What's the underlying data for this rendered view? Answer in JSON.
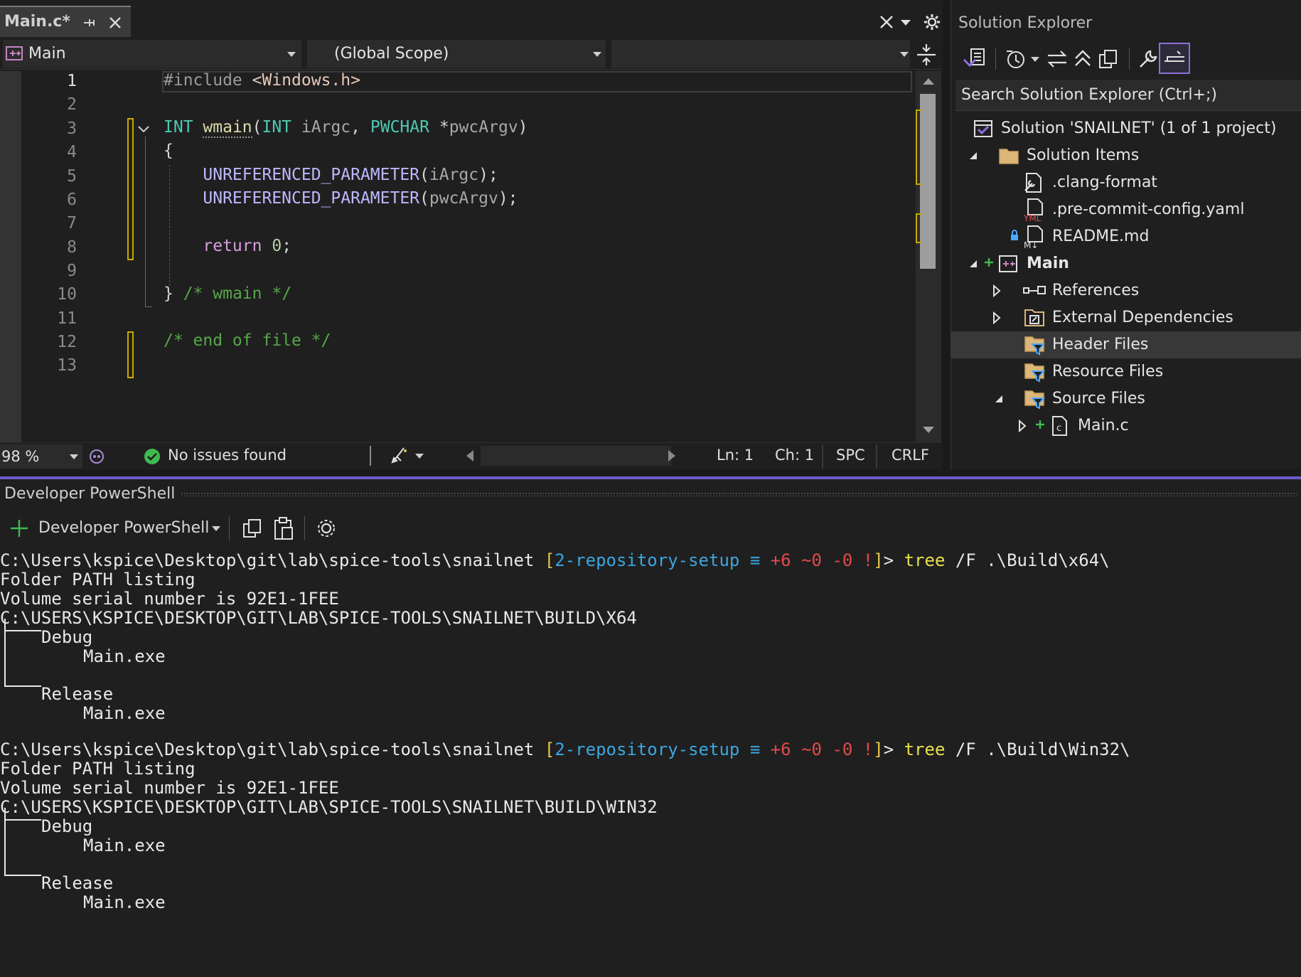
{
  "editor": {
    "tab": {
      "title": "Main.c*"
    },
    "nav": {
      "project": "Main",
      "scope": "(Global Scope)",
      "member": ""
    },
    "line_numbers": [
      "1",
      "2",
      "3",
      "4",
      "5",
      "6",
      "7",
      "8",
      "9",
      "10",
      "11",
      "12",
      "13"
    ],
    "code": {
      "l1_pp": "#include",
      "l1_inc": "<Windows.h>",
      "l3_type1": "INT",
      "l3_fn": "wmain",
      "l3_p1": "(",
      "l3_type2": "INT",
      "l3_arg1": "iArgc",
      "l3_comma": ",",
      "l3_type3": "PWCHAR",
      "l3_star": "*",
      "l3_arg2": "pwcArgv",
      "l3_p2": ")",
      "l4": "{",
      "l5_mac": "UNREFERENCED_PARAMETER",
      "l5_open": "(",
      "l5_arg": "iArgc",
      "l5_close": ");",
      "l6_mac": "UNREFERENCED_PARAMETER",
      "l6_open": "(",
      "l6_arg": "pwcArgv",
      "l6_close": ");",
      "l8_kw": "return",
      "l8_num": "0",
      "l8_semi": ";",
      "l10_brace": "}",
      "l10_com": "/* wmain */",
      "l12_com": "/* end of file */"
    },
    "status": {
      "zoom": "98 %",
      "issues": "No issues found",
      "ln": "Ln: 1",
      "ch": "Ch: 1",
      "spc": "SPC",
      "crlf": "CRLF"
    }
  },
  "solution_explorer": {
    "title": "Solution Explorer",
    "search_placeholder": "Search Solution Explorer (Ctrl+;)",
    "items": [
      {
        "label": "Solution 'SNAILNET' (1 of 1 project)"
      },
      {
        "label": "Solution Items"
      },
      {
        "label": ".clang-format"
      },
      {
        "label": ".pre-commit-config.yaml"
      },
      {
        "label": "README.md"
      },
      {
        "label": "Main"
      },
      {
        "label": "References"
      },
      {
        "label": "External Dependencies"
      },
      {
        "label": "Header Files"
      },
      {
        "label": "Resource Files"
      },
      {
        "label": "Source Files"
      },
      {
        "label": "Main.c"
      }
    ]
  },
  "terminal": {
    "panel_title": "Developer PowerShell",
    "dropdown": "Developer PowerShell",
    "block1": {
      "path": "C:\\Users\\kspice\\Desktop\\git\\lab\\spice-tools\\snailnet",
      "branch": "2-repository-setup",
      "status_eq": "≡",
      "status_add": "+6",
      "status_mod": "~0",
      "status_del": "-0",
      "status_excl": "!",
      "cmd": "tree",
      "args": "/F .\\Build\\x64\\",
      "out1": "Folder PATH listing",
      "out2": "Volume serial number is 92E1-1FEE",
      "out3": "C:\\USERS\\KSPICE\\DESKTOP\\GIT\\LAB\\SPICE-TOOLS\\SNAILNET\\BUILD\\X64",
      "debug": "Debug",
      "main1": "Main.exe",
      "release": "Release",
      "main2": "Main.exe"
    },
    "block2": {
      "path": "C:\\Users\\kspice\\Desktop\\git\\lab\\spice-tools\\snailnet",
      "branch": "2-repository-setup",
      "status_eq": "≡",
      "status_add": "+6",
      "status_mod": "~0",
      "status_del": "-0",
      "status_excl": "!",
      "cmd": "tree",
      "args": "/F .\\Build\\Win32\\",
      "out1": "Folder PATH listing",
      "out2": "Volume serial number is 92E1-1FEE",
      "out3": "C:\\USERS\\KSPICE\\DESKTOP\\GIT\\LAB\\SPICE-TOOLS\\SNAILNET\\BUILD\\WIN32",
      "debug": "Debug",
      "main1": "Main.exe",
      "release": "Release",
      "main2": "Main.exe"
    }
  }
}
